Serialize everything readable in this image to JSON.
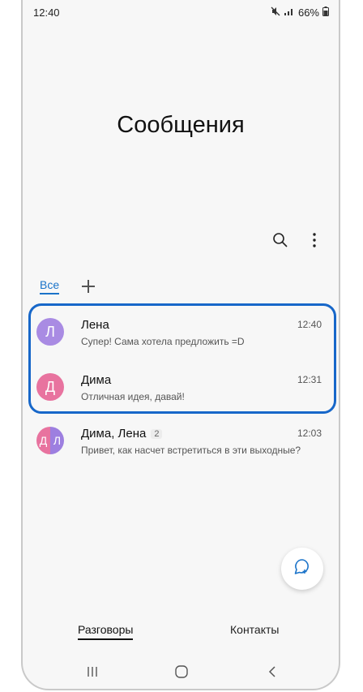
{
  "status_bar": {
    "time": "12:40",
    "battery": "66%"
  },
  "header": {
    "title": "Сообщения"
  },
  "tabs": {
    "all_label": "Все"
  },
  "conversations": [
    {
      "avatar_letter": "Л",
      "avatar_color": "#a98be3",
      "name": "Лена",
      "time": "12:40",
      "preview": "Супер! Сама хотела предложить =D"
    },
    {
      "avatar_letter": "Д",
      "avatar_color": "#e8739f",
      "name": "Дима",
      "time": "12:31",
      "preview": "Отличная идея, давай!"
    },
    {
      "avatar_letters": [
        "Д",
        "Л"
      ],
      "name": "Дима, Лена",
      "count": "2",
      "time": "12:03",
      "preview": "Привет, как насчет встретиться в эти выходные?"
    }
  ],
  "bottom_tabs": {
    "conversations": "Разговоры",
    "contacts": "Контакты"
  },
  "colors": {
    "accent": "#1a73c9",
    "highlight": "#1767c9"
  },
  "icons": [
    "search-icon",
    "more-icon",
    "add-tab-icon",
    "new-chat-icon",
    "recents-icon",
    "home-icon",
    "back-icon",
    "mute-icon",
    "signal-icon",
    "battery-icon"
  ]
}
